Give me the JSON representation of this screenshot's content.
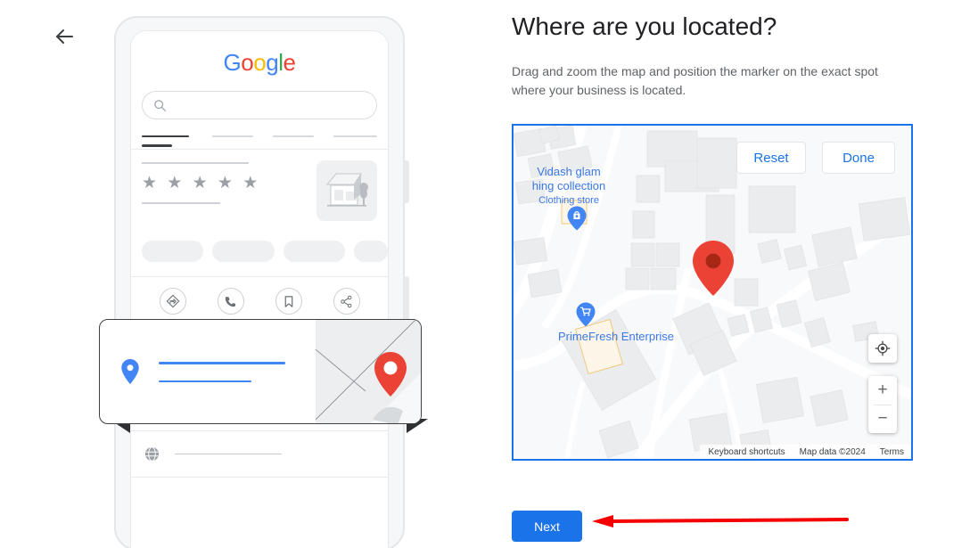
{
  "nav": {
    "back_label": "Back",
    "back_icon": "arrow-left-icon"
  },
  "heading": {
    "title": "Where are you located?",
    "subtitle": "Drag and zoom the map and position the marker on the exact spot where your business is located."
  },
  "phone_preview": {
    "google_logo": {
      "letters": [
        "G",
        "o",
        "o",
        "g",
        "l",
        "e"
      ]
    },
    "search_icon": "search-icon",
    "storefront_icon": "storefront-illustration",
    "rating_stars": "★ ★ ★ ★ ★",
    "star_count": 5,
    "action_icons": [
      "directions-icon",
      "phone-icon",
      "bookmark-icon",
      "share-icon"
    ],
    "info_icons": [
      "clock-icon",
      "phone-icon",
      "globe-icon"
    ],
    "card": {
      "pin_icon": "location-pin-icon",
      "map_marker_icon": "map-marker-icon"
    }
  },
  "map": {
    "reset_label": "Reset",
    "done_label": "Done",
    "recenter_icon": "recenter-crosshair-icon",
    "zoom_in_label": "+",
    "zoom_out_label": "−",
    "marker_icon": "red-map-marker",
    "pois": [
      {
        "name_line1": "Vidash glam",
        "name_line2": "hing collection",
        "category": "Clothing store",
        "icon": "shopping-bag-pin-icon"
      },
      {
        "name_line1": "PrimeFresh Enterprise",
        "icon": "shopping-cart-pin-icon"
      }
    ],
    "attribution": {
      "keyboard_shortcuts": "Keyboard shortcuts",
      "map_data": "Map data ©2024",
      "terms": "Terms"
    },
    "colors": {
      "border": "#1a73e8",
      "background": "#f8f9fa",
      "building": "#ebecee",
      "road": "#ffffff",
      "marker": "#ea4335",
      "poi_label": "#3b78e7"
    }
  },
  "footer": {
    "next_label": "Next",
    "annotation": "red-arrow-pointing-to-next"
  },
  "theme": {
    "accent_blue": "#1a73e8",
    "text_primary": "#202124",
    "text_secondary": "#5f6368",
    "annotation_red": "#f40000"
  }
}
